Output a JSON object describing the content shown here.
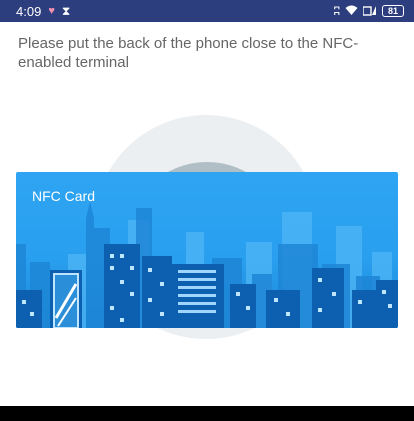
{
  "status_bar": {
    "time": "4:09",
    "battery": "81",
    "icons": [
      "heart-icon",
      "hourglass-icon",
      "bluetooth-icon",
      "wifi-icon",
      "signal-icon",
      "battery-icon"
    ]
  },
  "instruction": "Please put the back of the phone close to the NFC-enabled terminal",
  "card": {
    "label": "NFC Card"
  },
  "colors": {
    "status_bar": "#2c3e7e",
    "card_blue": "#29a0ef",
    "ring_outer": "#eceff1",
    "ring_inner": "#b0bec5"
  }
}
